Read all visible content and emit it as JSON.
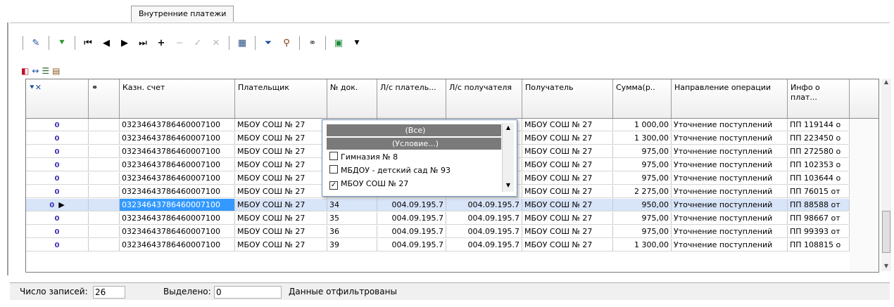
{
  "window": {
    "tab_label": "Внутренние платежи"
  },
  "toolbar": {
    "icons": [
      "edit-icon",
      "filter-green-icon",
      "first-record-icon",
      "prev-record-icon",
      "next-record-icon",
      "last-record-icon",
      "add-icon",
      "remove-icon",
      "confirm-icon",
      "cancel-icon",
      "calculator-icon",
      "filter-icon",
      "find-icon",
      "link-icon",
      "export-icon",
      "dropdown-arrow-icon"
    ]
  },
  "grid": {
    "headers": {
      "link": "⚭",
      "account": "Казн. счет",
      "payer": "Плательщик",
      "doc_no": "№ док.",
      "payer_ls": "Л/с платель...",
      "recipient_ls": "Л/с получателя",
      "recipient": "Получатель",
      "sum": "Сумма(р..",
      "direction": "Направление операции",
      "info": "Инфо о плат..."
    },
    "rows": [
      {
        "account": "03234643786460007100",
        "payer": "МБОУ СОШ № 27",
        "doc": "",
        "payer_ls": "",
        "rec_ls": "",
        "recipient": "МБОУ СОШ № 27",
        "sum": "1 000,00",
        "direction": "Уточнение поступлений",
        "info": "ПП 119144 о"
      },
      {
        "account": "03234643786460007100",
        "payer": "МБОУ СОШ № 27",
        "doc": "",
        "payer_ls": "",
        "rec_ls": "",
        "recipient": "МБОУ СОШ № 27",
        "sum": "1 300,00",
        "direction": "Уточнение поступлений",
        "info": "ПП 223450 о"
      },
      {
        "account": "03234643786460007100",
        "payer": "МБОУ СОШ № 27",
        "doc": "",
        "payer_ls": "",
        "rec_ls": "",
        "recipient": "МБОУ СОШ № 27",
        "sum": "975,00",
        "direction": "Уточнение поступлений",
        "info": "ПП 272580 о"
      },
      {
        "account": "03234643786460007100",
        "payer": "МБОУ СОШ № 27",
        "doc": "",
        "payer_ls": "",
        "rec_ls": "",
        "recipient": "МБОУ СОШ № 27",
        "sum": "975,00",
        "direction": "Уточнение поступлений",
        "info": "ПП 102353 о"
      },
      {
        "account": "03234643786460007100",
        "payer": "МБОУ СОШ № 27",
        "doc": "",
        "payer_ls": "",
        "rec_ls": "",
        "recipient": "МБОУ СОШ № 27",
        "sum": "975,00",
        "direction": "Уточнение поступлений",
        "info": "ПП 103644 о"
      },
      {
        "account": "03234643786460007100",
        "payer": "МБОУ СОШ № 27",
        "doc": "",
        "payer_ls": "",
        "rec_ls": "",
        "recipient": "МБОУ СОШ № 27",
        "sum": "2 275,00",
        "direction": "Уточнение поступлений",
        "info": "ПП 76015 от"
      },
      {
        "account": "03234643786460007100",
        "payer": "МБОУ СОШ № 27",
        "doc": "34",
        "payer_ls": "004.09.195.7",
        "rec_ls": "004.09.195.7",
        "recipient": "МБОУ СОШ № 27",
        "sum": "950,00",
        "direction": "Уточнение поступлений",
        "info": "ПП 88588 от"
      },
      {
        "account": "03234643786460007100",
        "payer": "МБОУ СОШ № 27",
        "doc": "35",
        "payer_ls": "004.09.195.7",
        "rec_ls": "004.09.195.7",
        "recipient": "МБОУ СОШ № 27",
        "sum": "975,00",
        "direction": "Уточнение поступлений",
        "info": "ПП 98667 от"
      },
      {
        "account": "03234643786460007100",
        "payer": "МБОУ СОШ № 27",
        "doc": "36",
        "payer_ls": "004.09.195.7",
        "rec_ls": "004.09.195.7",
        "recipient": "МБОУ СОШ № 27",
        "sum": "975,00",
        "direction": "Уточнение поступлений",
        "info": "ПП 99393 от"
      },
      {
        "account": "03234643786460007100",
        "payer": "МБОУ СОШ № 27",
        "doc": "39",
        "payer_ls": "004.09.195.7",
        "rec_ls": "004.09.195.7",
        "recipient": "МБОУ СОШ № 27",
        "sum": "1 300,00",
        "direction": "Уточнение поступлений",
        "info": "ПП 108815 о"
      }
    ]
  },
  "filter_dropdown": {
    "options": [
      {
        "label": "(Все)",
        "highlight": true,
        "checked": null
      },
      {
        "label": "(Условие...)",
        "highlight": true,
        "checked": null
      },
      {
        "label": "Гимназия № 8",
        "highlight": false,
        "checked": false
      },
      {
        "label": "МБДОУ - детский сад № 93",
        "highlight": false,
        "checked": false
      },
      {
        "label": "МБОУ СОШ № 27",
        "highlight": false,
        "checked": true
      }
    ]
  },
  "status": {
    "records_label": "Число записей:",
    "records_value": "26",
    "selected_label": "Выделено:",
    "selected_value": "0",
    "filter_message": "Данные отфильтрованы"
  }
}
